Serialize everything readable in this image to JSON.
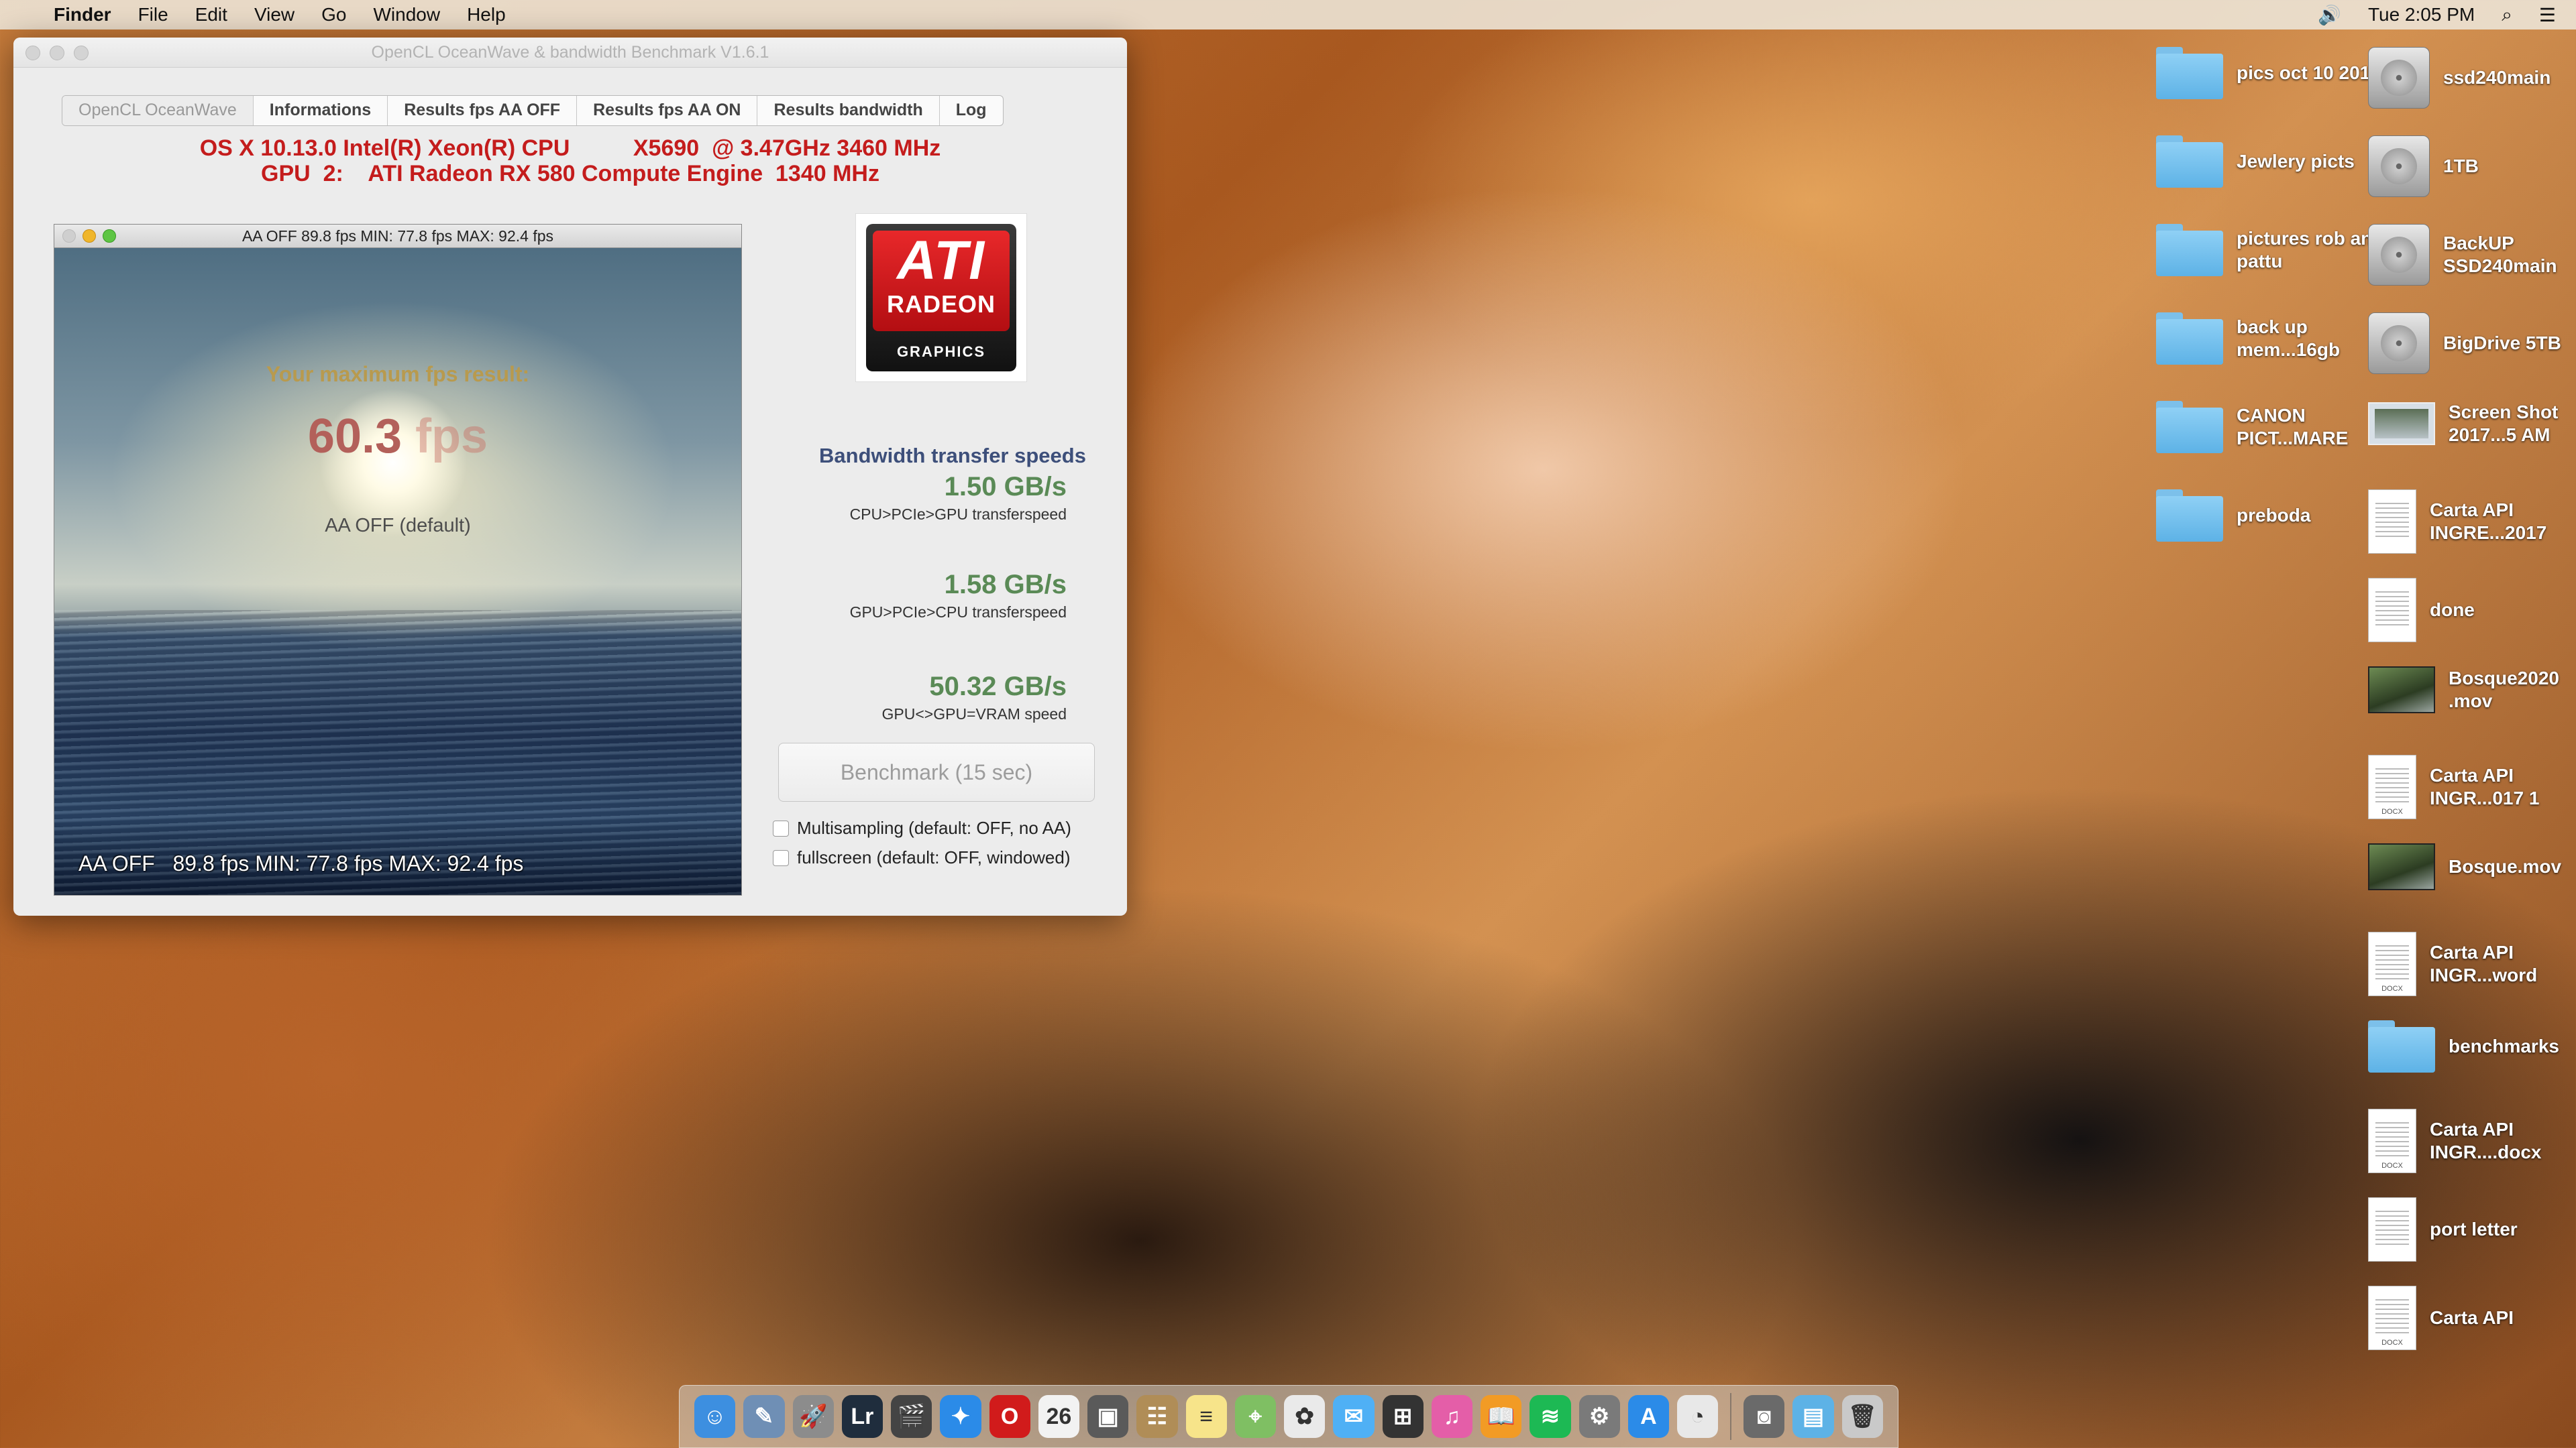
{
  "menubar": {
    "apple": "",
    "items": [
      "Finder",
      "File",
      "Edit",
      "View",
      "Go",
      "Window",
      "Help"
    ],
    "volume": "🔊",
    "clock": "Tue 2:05 PM",
    "search": "⌕",
    "list": "☰"
  },
  "window": {
    "title": "OpenCL OceanWave & bandwidth Benchmark V1.6.1",
    "tabs": [
      "OpenCL OceanWave",
      "Informations",
      "Results fps AA OFF",
      "Results fps AA ON",
      "Results bandwidth",
      "Log"
    ],
    "active_tab": 0,
    "sysinfo": {
      "line1": "OS X 10.13.0 Intel(R) Xeon(R) CPU          X5690  @ 3.47GHz 3460 MHz",
      "line2": "GPU  2:    ATI Radeon RX 580 Compute Engine  1340 MHz"
    },
    "render": {
      "bar_text": "AA OFF   89.8 fps MIN: 77.8 fps MAX: 92.4 fps",
      "result_label": "Your maximum fps result:",
      "fps_value": "60.3",
      "fps_unit": "fps",
      "aa_mode": "AA OFF (default)",
      "overlay": "AA OFF   89.8 fps MIN: 77.8 fps MAX: 92.4 fps"
    },
    "logo": {
      "brand": "ATI",
      "line": "RADEON",
      "sub": "GRAPHICS"
    },
    "bandwidth": {
      "title": "Bandwidth transfer speeds",
      "items": [
        {
          "value": "1.50 GB/s",
          "desc": "CPU>PCIe>GPU transferspeed"
        },
        {
          "value": "1.58 GB/s",
          "desc": "GPU>PCIe>CPU transferspeed"
        },
        {
          "value": "50.32 GB/s",
          "desc": "GPU<>GPU=VRAM speed"
        }
      ]
    },
    "benchmark_button": "Benchmark  (15 sec)",
    "options": {
      "multisampling": "Multisampling (default: OFF, no AA)",
      "fullscreen": "fullscreen (default: OFF, windowed)"
    }
  },
  "desktop": {
    "col1": [
      {
        "label": "pics oct 10 2015",
        "kind": "folder"
      },
      {
        "label": "Jewlery picts",
        "kind": "folder"
      },
      {
        "label": "pictures rob and pattu",
        "kind": "folder"
      },
      {
        "label": "back up mem...16gb",
        "kind": "folder"
      },
      {
        "label": "CANON PICT...MARE",
        "kind": "folder"
      },
      {
        "label": "preboda",
        "kind": "folder"
      }
    ],
    "col2": [
      {
        "label": "ssd240main",
        "kind": "drive"
      },
      {
        "label": "1TB",
        "kind": "drive"
      },
      {
        "label": "BackUP SSD240main",
        "kind": "drive"
      },
      {
        "label": "BigDrive 5TB",
        "kind": "drive"
      },
      {
        "label": "Screen Shot 2017...5 AM",
        "kind": "shot"
      },
      {
        "label": "Carta API INGRE...2017",
        "kind": "doc"
      },
      {
        "label": "done",
        "kind": "doc"
      },
      {
        "label": "Bosque2020 .mov",
        "kind": "movie"
      },
      {
        "label": "Carta API INGR...017 1",
        "kind": "docx"
      },
      {
        "label": "Bosque.mov",
        "kind": "movie"
      },
      {
        "label": "Carta API INGR...word",
        "kind": "docx"
      },
      {
        "label": "benchmarks",
        "kind": "folder"
      },
      {
        "label": "Carta API INGR....docx",
        "kind": "docx"
      },
      {
        "label": "port letter",
        "kind": "doc"
      },
      {
        "label": "Carta API",
        "kind": "docx"
      }
    ],
    "docx_tag": "DOCX"
  },
  "dock": {
    "apps": [
      {
        "name": "finder",
        "glyph": "☺",
        "color": "#3d8fe0"
      },
      {
        "name": "preview",
        "glyph": "✎",
        "color": "#6f8fb5"
      },
      {
        "name": "launchpad",
        "glyph": "🚀",
        "color": "#8c8c8c"
      },
      {
        "name": "lightroom",
        "glyph": "Lr",
        "color": "#1f2d3d"
      },
      {
        "name": "final-cut",
        "glyph": "🎬",
        "color": "#444444"
      },
      {
        "name": "safari",
        "glyph": "✦",
        "color": "#2b8be8"
      },
      {
        "name": "opera",
        "glyph": "O",
        "color": "#d11b1b"
      },
      {
        "name": "calendar",
        "glyph": "26",
        "color": "#f2f2f2"
      },
      {
        "name": "photo-booth",
        "glyph": "▣",
        "color": "#5a5a5a"
      },
      {
        "name": "contacts",
        "glyph": "☷",
        "color": "#b08d57"
      },
      {
        "name": "notes",
        "glyph": "≡",
        "color": "#f7e48a"
      },
      {
        "name": "maps",
        "glyph": "⌖",
        "color": "#7fbf63"
      },
      {
        "name": "photos",
        "glyph": "✿",
        "color": "#eaeaea"
      },
      {
        "name": "messages",
        "glyph": "✉",
        "color": "#4fb0f5"
      },
      {
        "name": "photo-collage",
        "glyph": "⊞",
        "color": "#333333"
      },
      {
        "name": "itunes",
        "glyph": "♫",
        "color": "#e45ea8"
      },
      {
        "name": "ibooks",
        "glyph": "📖",
        "color": "#f29b25"
      },
      {
        "name": "spotify",
        "glyph": "≋",
        "color": "#1db954"
      },
      {
        "name": "system-preferences",
        "glyph": "⚙",
        "color": "#7a7a7a"
      },
      {
        "name": "app-store",
        "glyph": "A",
        "color": "#2b8be8"
      },
      {
        "name": "opencl-benchmark",
        "glyph": "◔",
        "color": "#e8e8e8"
      }
    ],
    "right_apps": [
      {
        "name": "screenshot-tool",
        "glyph": "◙",
        "color": "#6a6a6a"
      },
      {
        "name": "downloads-folder",
        "glyph": "▤",
        "color": "#5db2e6"
      },
      {
        "name": "trash",
        "glyph": "🗑",
        "color": "#c9c9c9"
      }
    ]
  }
}
